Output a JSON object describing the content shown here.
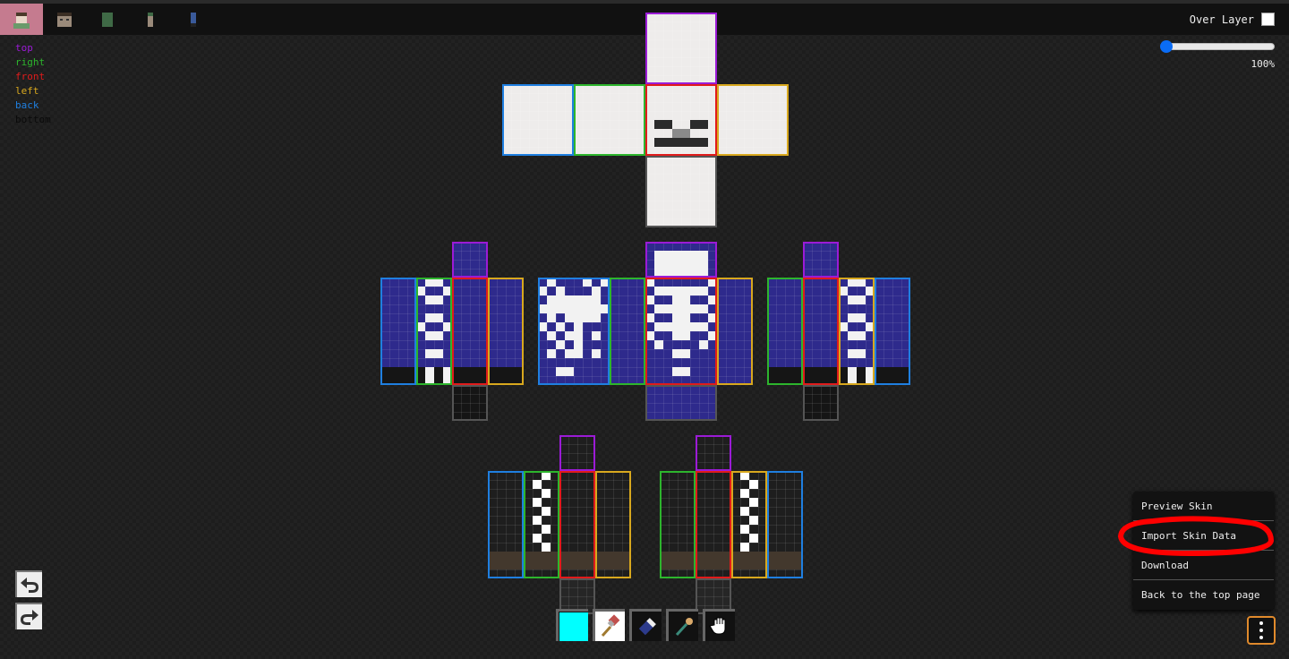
{
  "header": {
    "tabs": [
      {
        "name": "full-skin",
        "selected": true
      },
      {
        "name": "head"
      },
      {
        "name": "body"
      },
      {
        "name": "arm"
      },
      {
        "name": "leg"
      }
    ],
    "over_layer_label": "Over Layer",
    "over_layer_checked": false
  },
  "legend": [
    {
      "label": "top",
      "color": "#9b1bd6"
    },
    {
      "label": "right",
      "color": "#2db52d"
    },
    {
      "label": "front",
      "color": "#e01b1b"
    },
    {
      "label": "left",
      "color": "#d8a81e"
    },
    {
      "label": "back",
      "color": "#1f7fe0"
    },
    {
      "label": "bottom",
      "color": "#0a0a0a"
    }
  ],
  "zoom": {
    "label": "100%",
    "slider_fraction": 0
  },
  "history": {
    "undo": "undo-icon",
    "redo": "redo-icon"
  },
  "tools": [
    {
      "name": "color-swatch",
      "color": "#00ffff"
    },
    {
      "name": "brush-tool",
      "icon": "paintbrush-icon"
    },
    {
      "name": "eraser-tool",
      "icon": "eraser-icon"
    },
    {
      "name": "eyedropper-tool",
      "icon": "eyedropper-icon"
    },
    {
      "name": "hand-tool",
      "icon": "hand-icon"
    }
  ],
  "menu": {
    "items": [
      "Preview Skin",
      "Import Skin Data",
      "Download",
      "Back to the top page"
    ],
    "highlighted": "Import Skin Data",
    "highlight_color": "#ff0000"
  },
  "skin_colors": {
    "bone": "#eeeceb",
    "shirt": "#2e2a8c",
    "pants": "#1e1e1e",
    "band": "#43382d",
    "dark": "#151515"
  }
}
